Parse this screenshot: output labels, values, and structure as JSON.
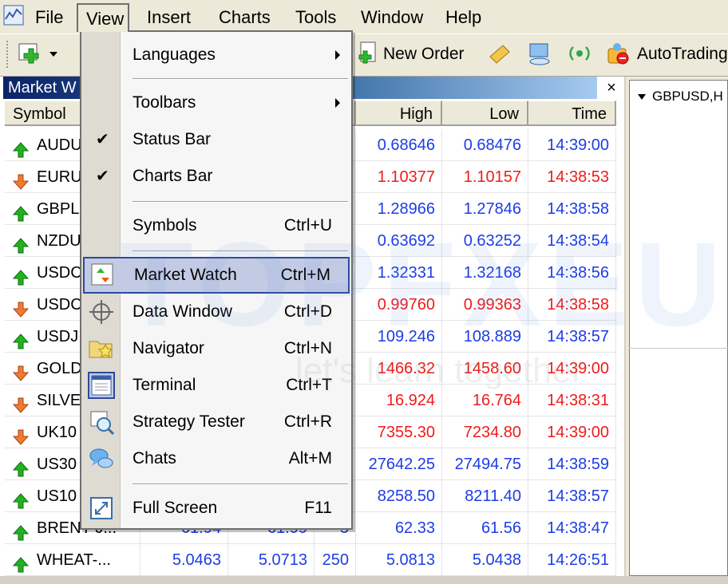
{
  "menubar": {
    "items": [
      "File",
      "View",
      "Insert",
      "Charts",
      "Tools",
      "Window",
      "Help"
    ],
    "active": "View"
  },
  "toolbar": {
    "new_order": "New Order",
    "autotrading": "AutoTrading"
  },
  "market_watch": {
    "title": "Market W",
    "close": "×",
    "columns": {
      "symbol": "Symbol",
      "high": "High",
      "low": "Low",
      "time": "Time"
    },
    "rows": [
      {
        "symbol": "AUDU",
        "dir": "up",
        "high": "0.68646",
        "low": "0.68476",
        "time": "14:39:00"
      },
      {
        "symbol": "EURU",
        "dir": "down",
        "high": "1.10377",
        "low": "1.10157",
        "time": "14:38:53"
      },
      {
        "symbol": "GBPL",
        "dir": "up",
        "high": "1.28966",
        "low": "1.27846",
        "time": "14:38:58"
      },
      {
        "symbol": "NZDU",
        "dir": "up",
        "high": "0.63692",
        "low": "0.63252",
        "time": "14:38:54"
      },
      {
        "symbol": "USDC",
        "dir": "up",
        "high": "1.32331",
        "low": "1.32168",
        "time": "14:38:56"
      },
      {
        "symbol": "USDC",
        "dir": "down",
        "high": "0.99760",
        "low": "0.99363",
        "time": "14:38:58"
      },
      {
        "symbol": "USDJ",
        "dir": "up",
        "high": "109.246",
        "low": "108.889",
        "time": "14:38:57"
      },
      {
        "symbol": "GOLD",
        "dir": "down",
        "high": "1466.32",
        "low": "1458.60",
        "time": "14:39:00"
      },
      {
        "symbol": "SILVE",
        "dir": "down",
        "high": "16.924",
        "low": "16.764",
        "time": "14:38:31"
      },
      {
        "symbol": "UK10",
        "dir": "down",
        "high": "7355.30",
        "low": "7234.80",
        "time": "14:39:00"
      },
      {
        "symbol": "US30",
        "dir": "up",
        "high": "27642.25",
        "low": "27494.75",
        "time": "14:38:59"
      },
      {
        "symbol": "US10",
        "dir": "up",
        "high": "8258.50",
        "low": "8211.40",
        "time": "14:38:57"
      },
      {
        "symbol": "BRENT-J...",
        "dir": "up",
        "bid": "61.94",
        "ask": "61.99",
        "spread": "5",
        "high": "62.33",
        "low": "61.56",
        "time": "14:38:47"
      },
      {
        "symbol": "WHEAT-...",
        "dir": "up",
        "bid": "5.0463",
        "ask": "5.0713",
        "spread": "250",
        "high": "5.0813",
        "low": "5.0438",
        "time": "14:26:51"
      }
    ]
  },
  "chart_panel": {
    "title": "GBPUSD,H"
  },
  "view_menu": {
    "languages": "Languages",
    "toolbars": "Toolbars",
    "status_bar": "Status Bar",
    "charts_bar": "Charts Bar",
    "symbols": "Symbols",
    "symbols_sc": "Ctrl+U",
    "market_watch": "Market Watch",
    "market_watch_sc": "Ctrl+M",
    "data_window": "Data Window",
    "data_window_sc": "Ctrl+D",
    "navigator": "Navigator",
    "navigator_sc": "Ctrl+N",
    "terminal": "Terminal",
    "terminal_sc": "Ctrl+T",
    "strategy_tester": "Strategy Tester",
    "strategy_tester_sc": "Ctrl+R",
    "chats": "Chats",
    "chats_sc": "Alt+M",
    "full_screen": "Full Screen",
    "full_screen_sc": "F11",
    "check": "✔"
  },
  "watermark": {
    "main": "TOPFXEU",
    "sub": "let's learn together"
  },
  "colors": {
    "up": "#1e3ce6",
    "down": "#ee1c1c",
    "highlight": "#c3cbe4"
  }
}
